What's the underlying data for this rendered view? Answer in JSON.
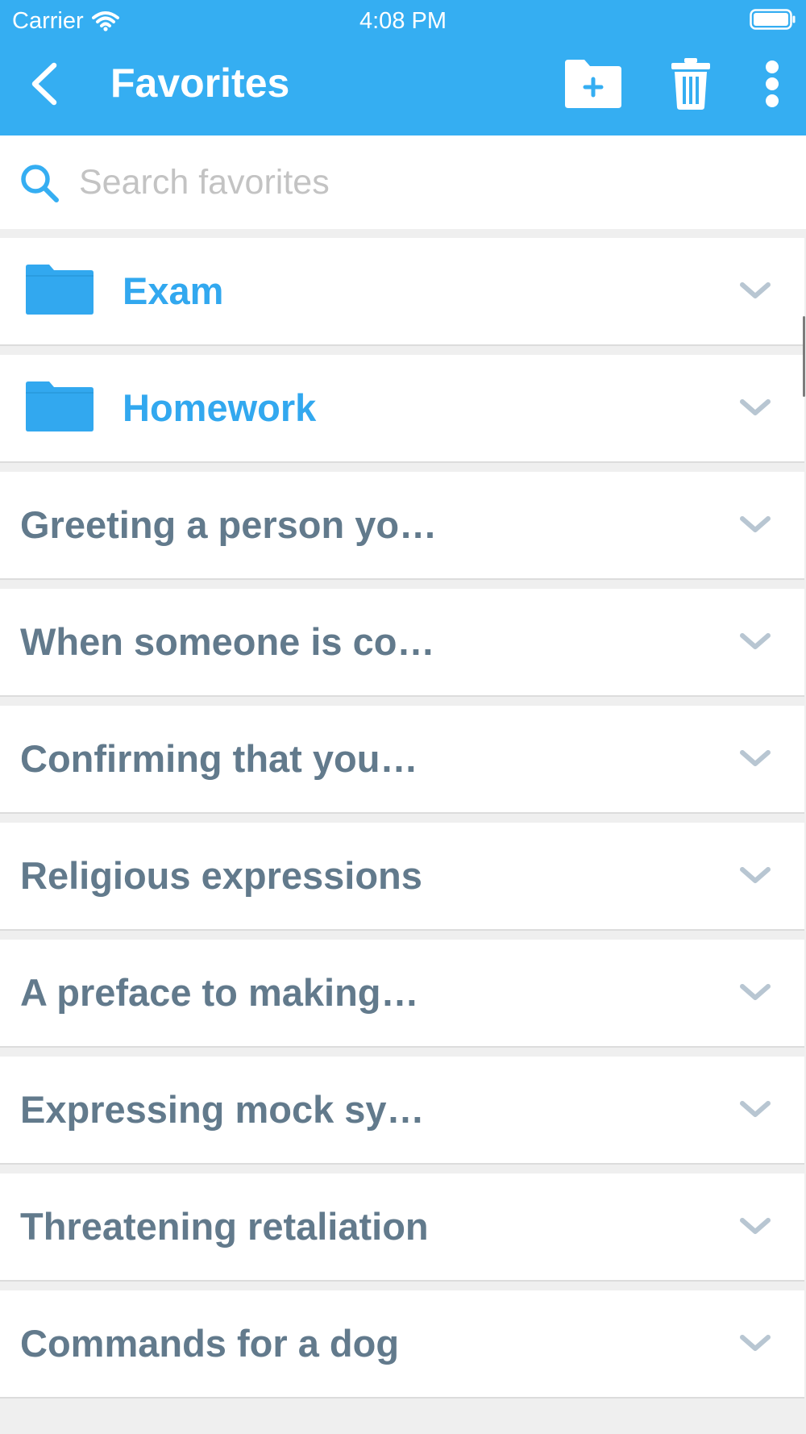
{
  "status_bar": {
    "carrier": "Carrier",
    "time": "4:08 PM",
    "icons": [
      "wifi-icon",
      "battery-icon"
    ]
  },
  "app_bar": {
    "title": "Favorites",
    "icons": {
      "back": "chevron-left-icon",
      "new_folder": "folder-plus-icon",
      "delete": "trash-icon",
      "more": "more-vertical-icon"
    }
  },
  "search": {
    "placeholder": "Search favorites",
    "value": ""
  },
  "folders": [
    {
      "label": "Exam"
    },
    {
      "label": "Homework"
    }
  ],
  "phrases": [
    {
      "label": "Greeting a person yo…"
    },
    {
      "label": "When someone is co…"
    },
    {
      "label": "Confirming that you…"
    },
    {
      "label": "Religious expressions"
    },
    {
      "label": "A preface to making…"
    },
    {
      "label": "Expressing mock sy…"
    },
    {
      "label": "Threatening retaliation"
    },
    {
      "label": "Commands for a dog"
    }
  ],
  "colors": {
    "header_bg": "#35aef2",
    "folder_accent": "#32a8ef",
    "phrase_text": "#627a8c",
    "chevron": "#b8c6d2",
    "page_bg": "#efefef"
  }
}
